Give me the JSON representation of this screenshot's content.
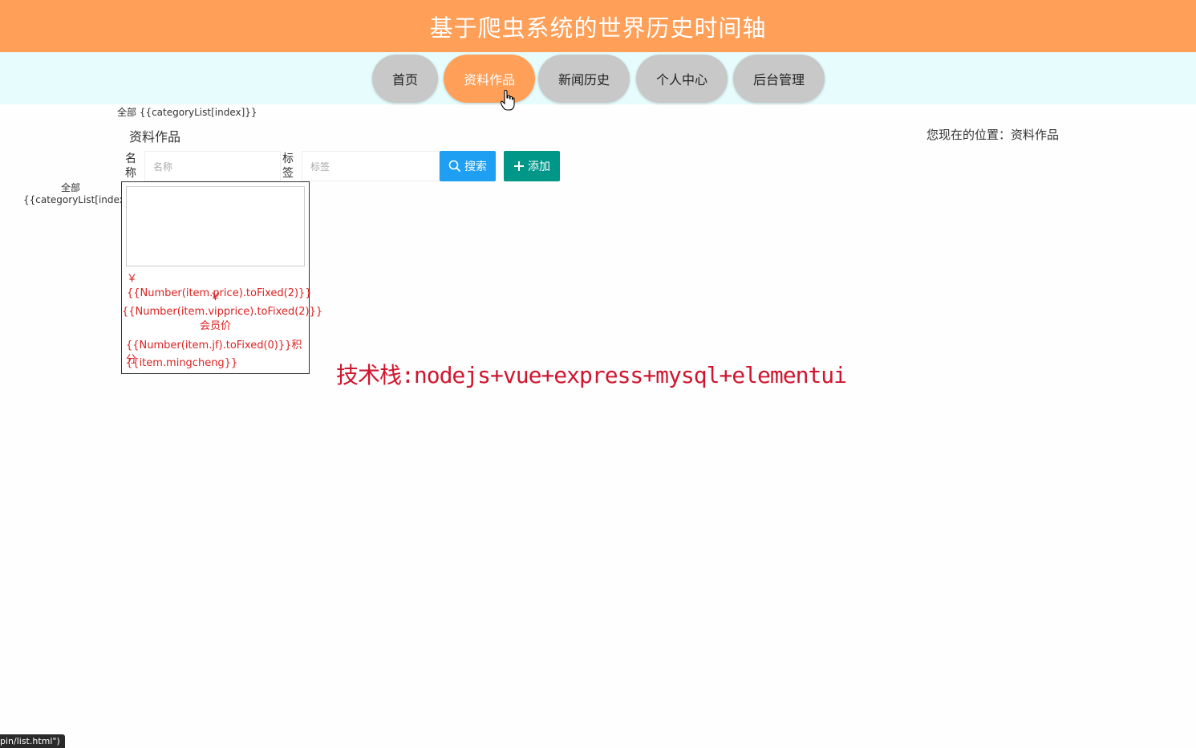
{
  "header": {
    "title": "基于爬虫系统的世界历史时间轴"
  },
  "nav": {
    "items": [
      {
        "label": "首页"
      },
      {
        "label": "资料作品"
      },
      {
        "label": "新闻历史"
      },
      {
        "label": "个人中心"
      },
      {
        "label": "后台管理"
      }
    ],
    "active": "资料作品"
  },
  "category_top": "全部 {{categoryList[index]}}",
  "page": {
    "title": "资料作品",
    "location": "您现在的位置：资料作品"
  },
  "search": {
    "name_label_1": "名",
    "name_label_2": "称",
    "name_placeholder": "名称",
    "tag_label_1": "标",
    "tag_label_2": "签",
    "tag_placeholder": "标签",
    "search_button": "搜索",
    "add_button": "添加"
  },
  "side_category": {
    "line1": "全部",
    "line2": "{{categoryList[index]}}"
  },
  "card": {
    "price": "￥{{Number(item.price).toFixed(2)}}",
    "vip_symbol": "￥",
    "vip_price": "{{Number(item.vipprice).toFixed(2)}}",
    "vip_label": "会员价",
    "points": "{{Number(item.jf).toFixed(0)}}积分",
    "name": "{{item.mingcheng}}"
  },
  "overlay_text": "技术栈:nodejs+vue+express+mysql+elementui",
  "status_tip": "pin/list.html\")",
  "colors": {
    "header": "#ff9f58",
    "navbar": "#e6fcfd",
    "search_button": "#1e9ff2",
    "add_button": "#009688",
    "price_text": "#dd2222"
  }
}
